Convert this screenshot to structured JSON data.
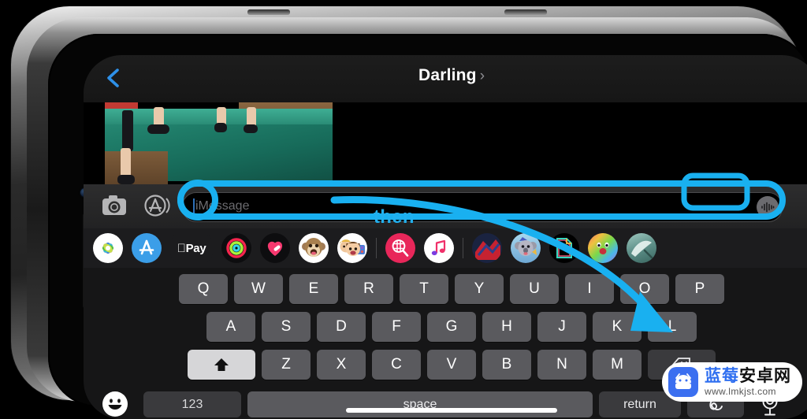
{
  "device": {
    "type": "iphone-landscape",
    "frame_color": "#b9b9b9",
    "screen_bg": "#000000"
  },
  "nav": {
    "back_icon": "chevron-left-icon",
    "back_color": "#2e90e8",
    "title": "Darling",
    "detail_chevron": "chevron-right-icon"
  },
  "thread": {
    "attachment_type": "video-thumbnail",
    "attachment_description": "green gymnastics mat with legs"
  },
  "input_bar": {
    "camera_icon": "camera-icon",
    "appstore_icon": "app-store-icon",
    "placeholder": "iMessage",
    "value": "",
    "audio_icon": "audio-waveform-icon"
  },
  "app_drawer": {
    "items": [
      {
        "name": "photos",
        "label": "Photos"
      },
      {
        "name": "app-store",
        "label": "App Store"
      },
      {
        "name": "apple-pay",
        "label": "Apple Pay"
      },
      {
        "name": "activity",
        "label": "Activity"
      },
      {
        "name": "health",
        "label": "Health"
      },
      {
        "name": "memoji-monkey",
        "label": "Memoji Monkey"
      },
      {
        "name": "memoji-people",
        "label": "Memoji People"
      },
      {
        "name": "images-search",
        "label": "#images"
      },
      {
        "name": "music",
        "label": "Music"
      },
      {
        "name": "sticker-red",
        "label": "Sticker Pack"
      },
      {
        "name": "sticker-koala",
        "label": "Koala Stickers"
      },
      {
        "name": "file-doc",
        "label": "Documents"
      },
      {
        "name": "rainbow-face",
        "label": "Rainbow Sticker"
      },
      {
        "name": "teal-shell",
        "label": "Teal Sticker"
      }
    ]
  },
  "keyboard": {
    "row1": [
      "Q",
      "W",
      "E",
      "R",
      "T",
      "Y",
      "U",
      "I",
      "O",
      "P"
    ],
    "row2": [
      "A",
      "S",
      "D",
      "F",
      "G",
      "H",
      "J",
      "K",
      "L"
    ],
    "row3": [
      "Z",
      "X",
      "C",
      "V",
      "B",
      "N",
      "M"
    ],
    "shift_icon": "shift-arrow-up-icon",
    "shift_active": true,
    "backspace_icon": "backspace-icon",
    "emoji_icon": "emoji-smiley-icon",
    "numbers_key": "123",
    "space_key": "space",
    "return_key": "return",
    "scribble_icon": "scribble-handwriting-icon",
    "mic_icon": "microphone-icon",
    "home_indicator": true
  },
  "annotations": {
    "label": "then",
    "label_color": "#22b0ee",
    "highlight_color": "#19b0f0",
    "highlight_field": "imessage-input-field",
    "highlight_key": "scribble-key",
    "arrow": "curved-arrow-pointing-to-scribble-key"
  },
  "watermark": {
    "brand_cn_blue": "蓝莓",
    "brand_cn_dark": "安卓网",
    "url": "www.lmkjst.com",
    "logo_icon": "android-robot-icon"
  }
}
